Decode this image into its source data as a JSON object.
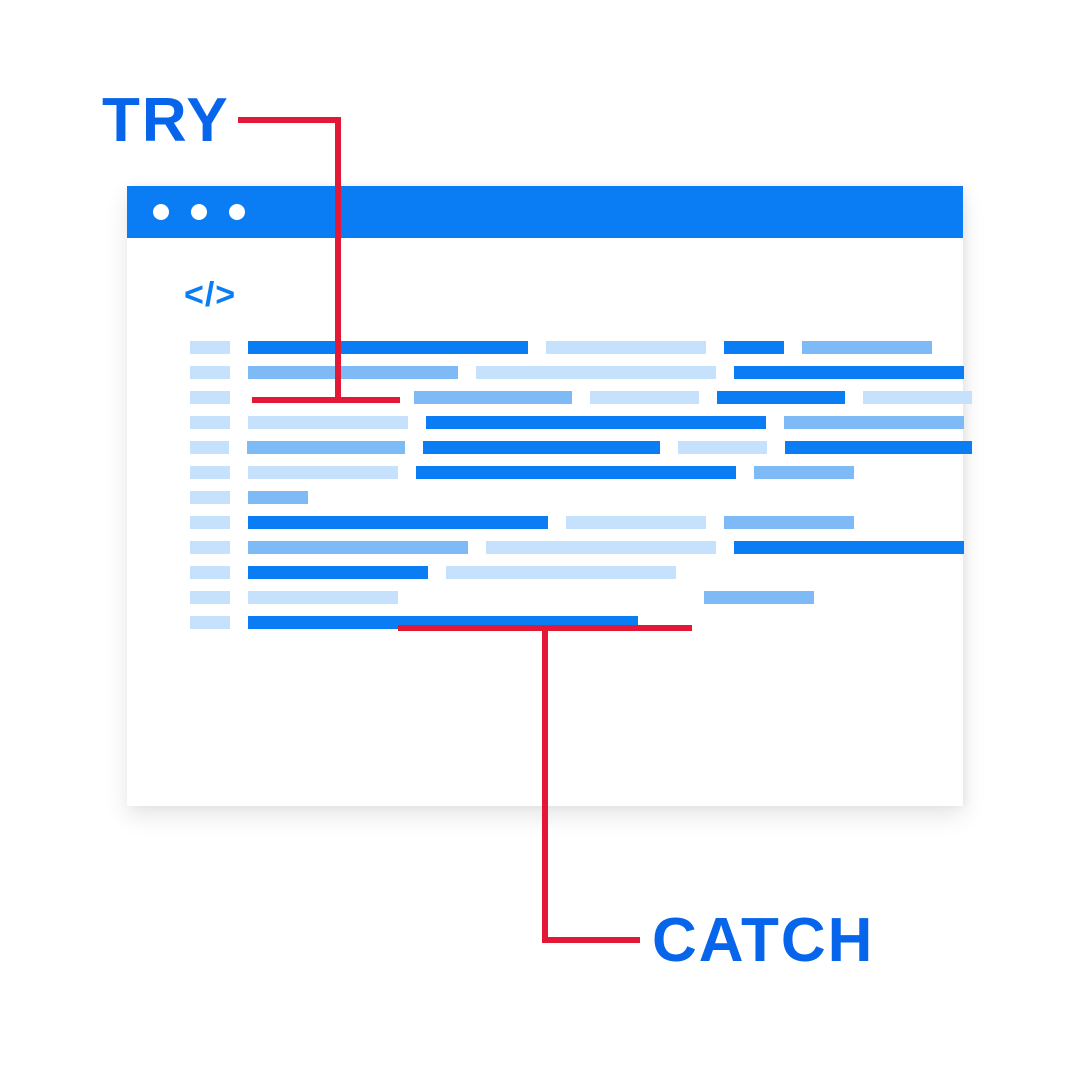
{
  "labels": {
    "try": "TRY",
    "catch": "CATCH"
  },
  "code_icon": "</>",
  "colors": {
    "brand_blue": "#0b7df4",
    "light_blue": "#c5e1fb",
    "mid_blue": "#7ebaf6",
    "connector_red": "#e31837",
    "text_blue": "#0765eb"
  }
}
